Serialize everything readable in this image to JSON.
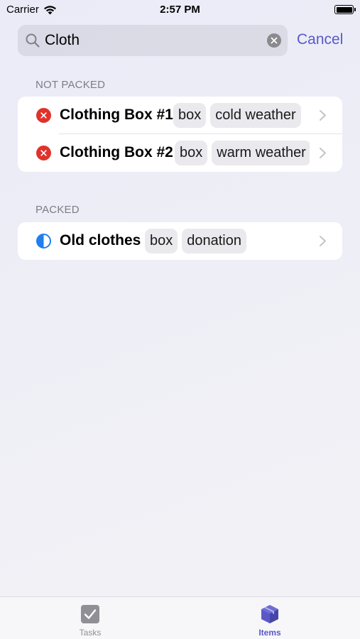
{
  "status_bar": {
    "carrier": "Carrier",
    "time": "2:57 PM",
    "wifi_icon": "wifi-icon",
    "battery_icon": "battery-icon"
  },
  "search": {
    "value": "Cloth",
    "icon": "search-icon",
    "clear_icon": "clear-icon",
    "cancel_label": "Cancel"
  },
  "sections": {
    "not_packed": {
      "header": "NOT PACKED",
      "items": [
        {
          "title": "Clothing Box #1",
          "status": "not-packed",
          "tags": [
            "box",
            "cold weather"
          ]
        },
        {
          "title": "Clothing Box #2",
          "status": "not-packed",
          "tags": [
            "box",
            "warm weather"
          ]
        }
      ]
    },
    "packed": {
      "header": "PACKED",
      "items": [
        {
          "title": "Old clothes",
          "status": "partially-packed",
          "tags": [
            "box",
            "donation"
          ]
        }
      ]
    }
  },
  "tab_bar": {
    "tasks_label": "Tasks",
    "items_label": "Items",
    "tasks_icon": "checkbox-icon",
    "items_icon": "box-icon"
  },
  "colors": {
    "accent": "#5a59c9",
    "not_packed": "#e0322b",
    "partial": "#1e7ff0"
  }
}
